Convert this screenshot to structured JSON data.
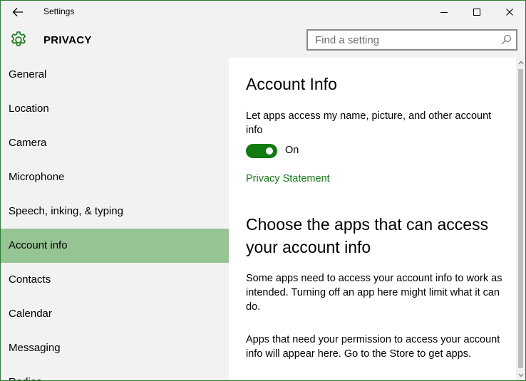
{
  "window": {
    "title": "Settings",
    "controls": {
      "minimize": "minimize-icon",
      "maximize": "maximize-icon",
      "close": "close-icon"
    }
  },
  "header": {
    "section": "PRIVACY",
    "search_placeholder": "Find a setting"
  },
  "sidebar": {
    "items": [
      {
        "label": "General",
        "active": false
      },
      {
        "label": "Location",
        "active": false
      },
      {
        "label": "Camera",
        "active": false
      },
      {
        "label": "Microphone",
        "active": false
      },
      {
        "label": "Speech, inking, & typing",
        "active": false
      },
      {
        "label": "Account info",
        "active": true
      },
      {
        "label": "Contacts",
        "active": false
      },
      {
        "label": "Calendar",
        "active": false
      },
      {
        "label": "Messaging",
        "active": false
      },
      {
        "label": "Radios",
        "active": false
      }
    ]
  },
  "content": {
    "heading": "Account Info",
    "toggle_description": "Let apps access my name, picture, and other account info",
    "toggle_state": "On",
    "privacy_link": "Privacy Statement",
    "apps_heading": "Choose the apps that can access your account info",
    "apps_paragraph": "Some apps need to access your account info to work as intended. Turning off an app here might limit what it can do.",
    "store_paragraph": "Apps that need your permission to access your account info will appear here. Go to the Store to get apps."
  },
  "colors": {
    "accent": "#107c10",
    "selected_nav": "#97c493",
    "window_border": "#2d7d32",
    "sidebar_bg": "#f2f2f2"
  }
}
